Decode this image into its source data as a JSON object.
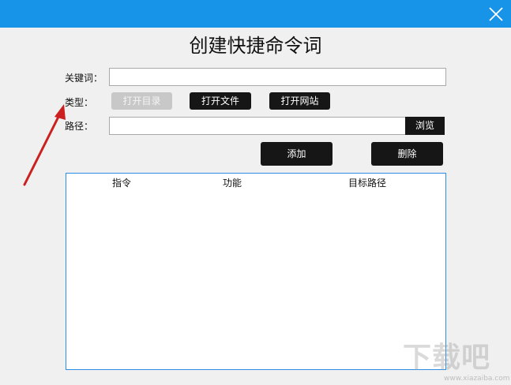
{
  "window": {
    "title": "创建快捷命令词",
    "accent_color": "#1793e8",
    "close_icon": "close-icon"
  },
  "form": {
    "keyword_label": "关键词：",
    "keyword_value": "",
    "type_label": "类型：",
    "type_buttons": {
      "open_directory": "打开目录",
      "open_file": "打开文件",
      "open_website": "打开网站"
    },
    "path_label": "路径：",
    "path_value": "",
    "browse_label": "浏览"
  },
  "actions": {
    "add_label": "添加",
    "delete_label": "删除"
  },
  "list": {
    "columns": [
      "指令",
      "功能",
      "目标路径"
    ],
    "rows": []
  },
  "watermark": {
    "text": "下载吧",
    "url": "www.xiazaiba.com"
  }
}
